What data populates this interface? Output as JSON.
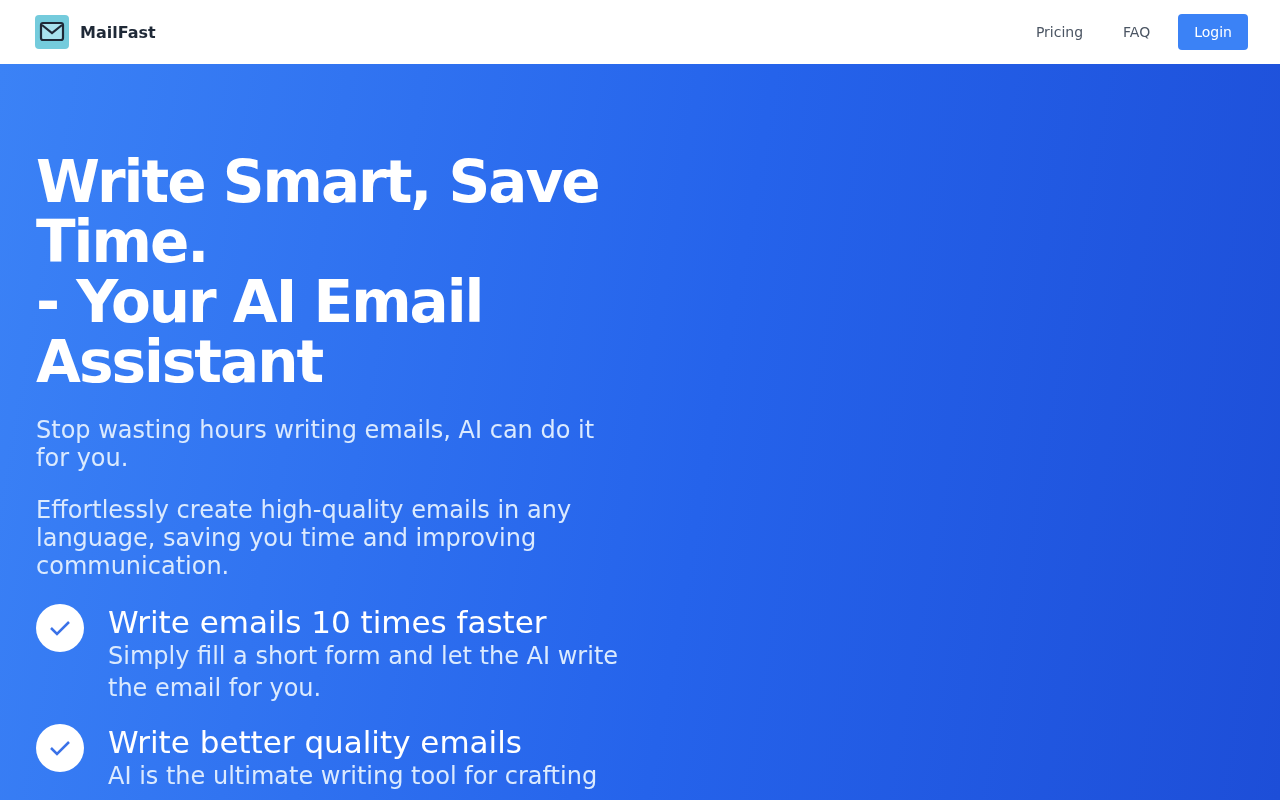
{
  "header": {
    "brand": "MailFast",
    "nav": [
      {
        "label": "Pricing",
        "kind": "link"
      },
      {
        "label": "FAQ",
        "kind": "link"
      },
      {
        "label": "Login",
        "kind": "button"
      }
    ]
  },
  "hero": {
    "title_lines": [
      "Write Smart, Save Time.",
      "- Your AI Email Assistant"
    ],
    "subtitle": "Stop wasting hours writing emails, AI can do it for you.",
    "description": "Effortlessly create high-quality emails in any language, saving you time and improving communication.",
    "features": [
      {
        "title": "Write emails 10 times faster",
        "text": "Simply fill a short form and let the AI write the email for you."
      },
      {
        "title": "Write better quality emails",
        "text": "AI is the ultimate writing tool for crafting"
      }
    ]
  }
}
